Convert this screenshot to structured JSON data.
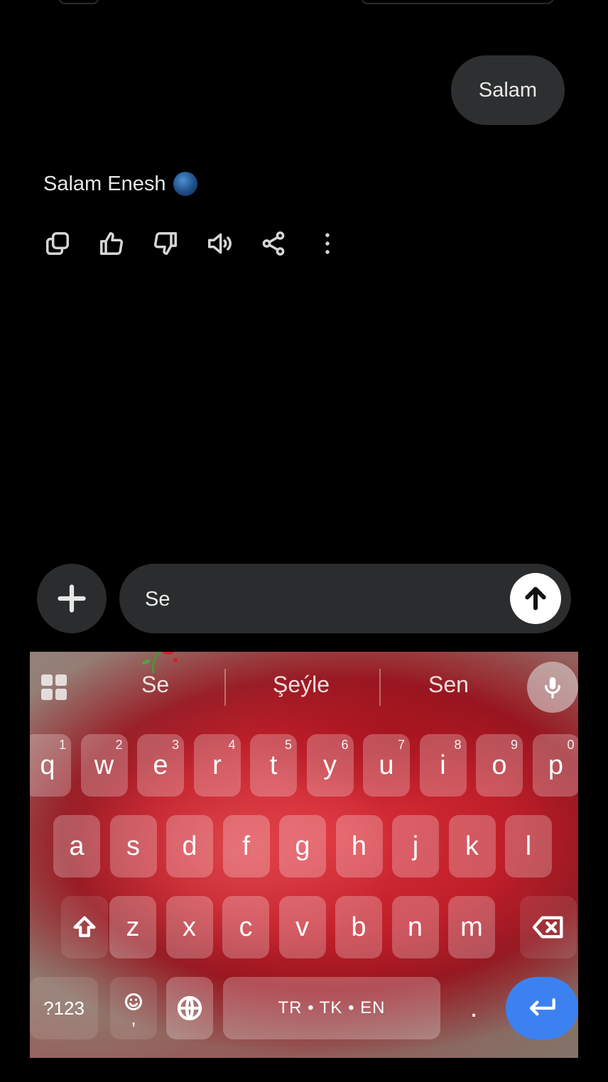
{
  "chat": {
    "sent_message": "Salam",
    "reply_text": "Salam Enesh",
    "reply_emoji": "globe-emoji",
    "actions": [
      "copy-icon",
      "thumbs-up-icon",
      "thumbs-down-icon",
      "speaker-icon",
      "share-icon",
      "more-vertical-icon"
    ]
  },
  "composer": {
    "input_value": "Se",
    "add_icon": "plus-icon",
    "send_icon": "arrow-up-icon"
  },
  "keyboard": {
    "suggestions": [
      "Se",
      "Şeýle",
      "Sen"
    ],
    "row1": [
      {
        "key": "q",
        "hint": "1"
      },
      {
        "key": "w",
        "hint": "2"
      },
      {
        "key": "e",
        "hint": "3"
      },
      {
        "key": "r",
        "hint": "4"
      },
      {
        "key": "t",
        "hint": "5"
      },
      {
        "key": "y",
        "hint": "6"
      },
      {
        "key": "u",
        "hint": "7"
      },
      {
        "key": "i",
        "hint": "8"
      },
      {
        "key": "o",
        "hint": "9"
      },
      {
        "key": "p",
        "hint": "0"
      }
    ],
    "row2": [
      "a",
      "s",
      "d",
      "f",
      "g",
      "h",
      "j",
      "k",
      "l"
    ],
    "row3": [
      "z",
      "x",
      "c",
      "v",
      "b",
      "n",
      "m"
    ],
    "symbols_label": "?123",
    "comma_label": ",",
    "space_label": "TR • TK • EN",
    "period_label": ".",
    "colors": {
      "enter": "#3b82f0",
      "background_accent": "#c01f2a"
    }
  }
}
